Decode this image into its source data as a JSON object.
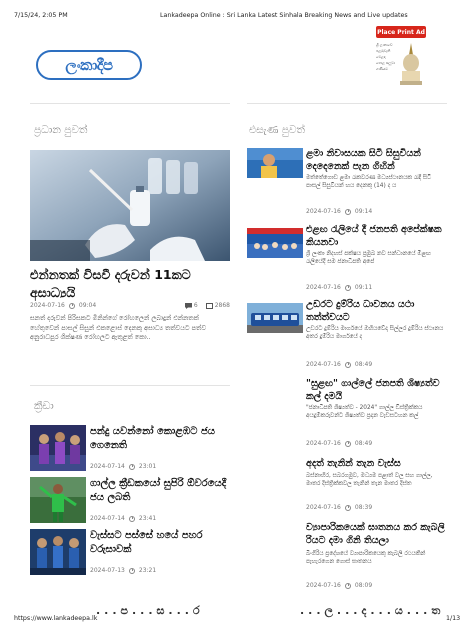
{
  "print_header": {
    "datetime": "7/15/24, 2:05 PM",
    "page_title": "Lankadeepa Online : Sri Lanka Latest Sinhala Breaking News and Live updates"
  },
  "site": {
    "logo_text": "ලංකාදීප",
    "brand_color": "#2d6fc0"
  },
  "ad": {
    "label": "Place Print Ad",
    "lines": [
      "ශ්‍රී ලංකාවේ",
      "පළමුවැනි වෙළඳ",
      "පොළ සලුවා",
      "ගණියට"
    ]
  },
  "sections": {
    "main_news_title": "ප්‍රධාන පුවත්",
    "latest_news_title": "එසැණ පුවත්",
    "sports_title": "ක්‍රීඩා"
  },
  "feature": {
    "title": "එන්නතක් විසවී දරුවන් 11කට අසාධ්‍යයි",
    "date": "2024-07-16",
    "time": "09:04",
    "comments": "6",
    "views": "2868",
    "excerpt": "සනත් දරුවන් පිරිසකට මිනින්ගේ රෝහලෙන් ලබාදුන් එන්නතක් හේතුවෙන් පාසල් සිසුන් එකළොස් දෙනකු අසාධ්‍ය තත්වයට පත්ව අනුරාධපුර ශික්ෂණ රෝහලට ඇතුළත් කො.."
  },
  "sports": [
    {
      "title": "පන්දු යවන්නෝ කොළඹට ජය ගෙනෙති",
      "date": "2024-07-14",
      "time": "23:01"
    },
    {
      "title": "ගාල්ල ක්‍රීඩකයෝ සුපිරි ඕවරයෙදී ජය ලබති",
      "date": "2024-07-14",
      "time": "23:41"
    },
    {
      "title": "වැස්සට පස්සේ හයේ පහර වරුසාවක්",
      "date": "2024-07-13",
      "time": "23:21"
    }
  ],
  "latest": [
    {
      "title": "ළමා නිවාසයක සිටි සිසුවියන් දෙදෙනෙක් පැන ගිහින්",
      "excerpt": "මත්තේගොඩ ළමා රැකවරණ මධ්‍යස්ථානයක රැඳී සිටි පාසල් සිසුවියන් හය දෙනකු (14) ද ය",
      "date": "2024-07-16",
      "time": "09:14"
    },
    {
      "title": "එළඟ රැලියේ දී ජනපති අපේක්ෂක කියනවා",
      "excerpt": "ශ්‍රී ලංකා නිදහස් පක්ෂය ප්‍රමුඛ නව සන්ධානයේ මීළඟ රැලියේදී සම ජනාධිපති අපේ",
      "date": "2024-07-16",
      "time": "09:11"
    },
    {
      "title": "උඩරට දුම්රිය ධාවනය යථා තත්ත්වයට",
      "excerpt": "උඩරට දුම්රිය මාර්ගයේ ඔහියවේදා සිල්ලර දුම්රිය ස්ථානය අතර දුම්රිය මාර්ගයේ ද",
      "date": "2024-07-16",
      "time": "08:49"
    },
    {
      "title": "\"සුළඟ\" ගාල්ලේ ජනපති ශිෂ්‍යත්ව කල් දමයි",
      "excerpt": "\"ජනාධිපති ශිෂ්‍යත්ව - 2024\" ගාල්ල ඩිස්ත්‍රික්කය අයදුම්කරුවන්ට ශිෂ්‍යත්ව ප්‍රදාන වැඩසටහන කල්",
      "date": "2024-07-16",
      "time": "08:49"
    },
    {
      "title": "අදත් තැනින් තැන වැස්ස",
      "excerpt": "බස්නාහිර, සබරගමුව, මධ්‍යම පළාත් වල සහ ගාල්ල, මාතර දිස්ත්‍රික්කවල තැනින් තැන මාතර දිස්ත",
      "date": "2024-07-16",
      "time": "08:39"
    },
    {
      "title": "ව්‍යාපාරිකයෙක් ඝාතනය කර කැබලි රියට දමා ගිනි තියලා",
      "excerpt": "බිංගිරිය ප්‍රදේශයේ ව්‍යාපාරිකයෙකු කැබලි රථයකින් පැහැරගෙන ගොස් ඝාතනය",
      "date": "2024-07-16",
      "time": "08:09"
    }
  ],
  "bottom_cut_left": "...ප...ස...ර",
  "bottom_cut_right": "...ල...ද...ය...ත",
  "print_footer": {
    "url": "https://www.lankadeepa.lk",
    "page": "1/13"
  }
}
